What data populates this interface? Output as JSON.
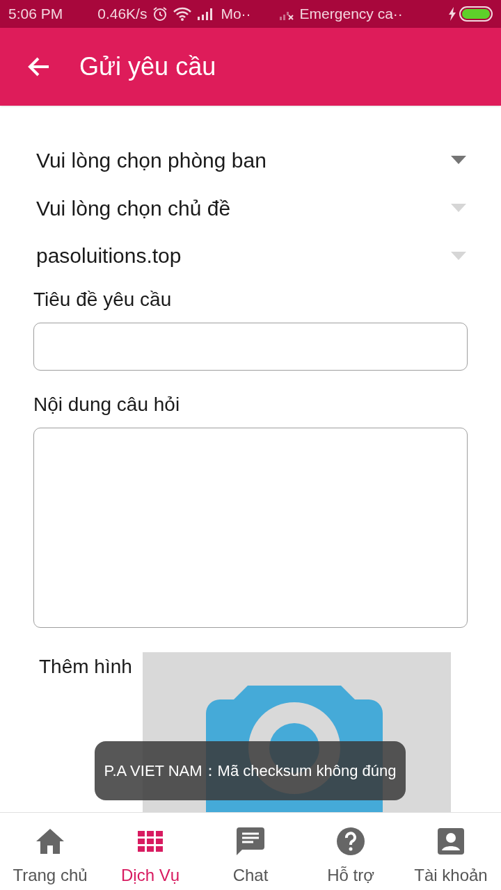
{
  "status_bar": {
    "time": "5:06 PM",
    "speed": "0.46K/s",
    "carrier_1": "Mo··",
    "carrier_2": "Emergency ca··"
  },
  "app_bar": {
    "title": "Gửi yêu cầu"
  },
  "dropdowns": [
    {
      "value": "Vui lòng chọn phòng ban",
      "disabled": false
    },
    {
      "value": "Vui lòng chọn chủ đề",
      "disabled": true
    },
    {
      "value": "pasoluitions.top",
      "disabled": true
    }
  ],
  "fields": [
    {
      "kind": "input",
      "label": "Tiêu đề yêu cầu"
    },
    {
      "kind": "textarea",
      "label": "Nội dung câu hỏi"
    }
  ],
  "add_image": {
    "label": "Thêm hình"
  },
  "toast": "P.A VIET NAM：Mã checksum không đúng",
  "nav": [
    {
      "kind": "home",
      "label": "Trang chủ",
      "selected": false
    },
    {
      "kind": "grid",
      "label": "Dịch Vụ",
      "selected": true
    },
    {
      "kind": "chat",
      "label": "Chat",
      "selected": false
    },
    {
      "kind": "help",
      "label": "Hỗ trợ",
      "selected": false
    },
    {
      "kind": "account",
      "label": "Tài khoản",
      "selected": false
    }
  ]
}
